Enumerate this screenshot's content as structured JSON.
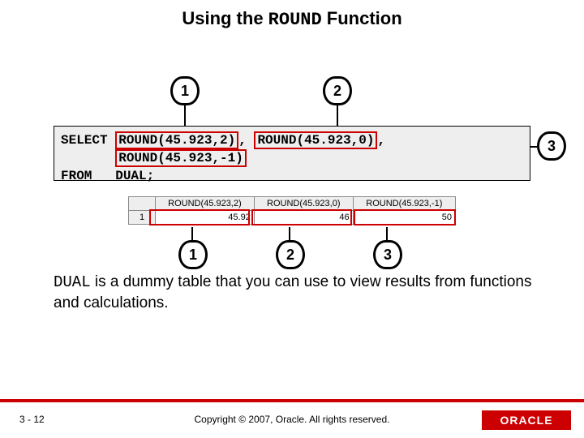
{
  "title": {
    "pre": "Using the ",
    "kw": "ROUND",
    "post": " Function"
  },
  "code": {
    "select_kw": "SELECT ",
    "expr1": "ROUND(45.923,2)",
    "sep1": ", ",
    "expr2": "ROUND(45.923,0)",
    "sep2": ",",
    "line2_pad": "       ",
    "expr3": "ROUND(45.923,-1)",
    "from_kw": "FROM   ",
    "tbl": "DUAL;"
  },
  "top_bubbles": {
    "b1": "1",
    "b2": "2",
    "b3": "3"
  },
  "grid": {
    "headers": [
      "ROUND(45.923,2)",
      "ROUND(45.923,0)",
      "ROUND(45.923,-1)"
    ],
    "rownum": "1",
    "values": [
      "45.92",
      "46",
      "50"
    ]
  },
  "bottom_bubbles": {
    "b1": "1",
    "b2": "2",
    "b3": "3"
  },
  "note": {
    "kw": "DUAL",
    "rest": " is a dummy table that you can use to view results from functions and calculations."
  },
  "footer": {
    "page": "3 - 12",
    "copyright": "Copyright © 2007, Oracle. All rights reserved.",
    "logo": "ORACLE"
  },
  "chart_data": {
    "type": "table",
    "headers": [
      "ROUND(45.923,2)",
      "ROUND(45.923,0)",
      "ROUND(45.923,-1)"
    ],
    "rows": [
      [
        45.92,
        46,
        50
      ]
    ]
  }
}
